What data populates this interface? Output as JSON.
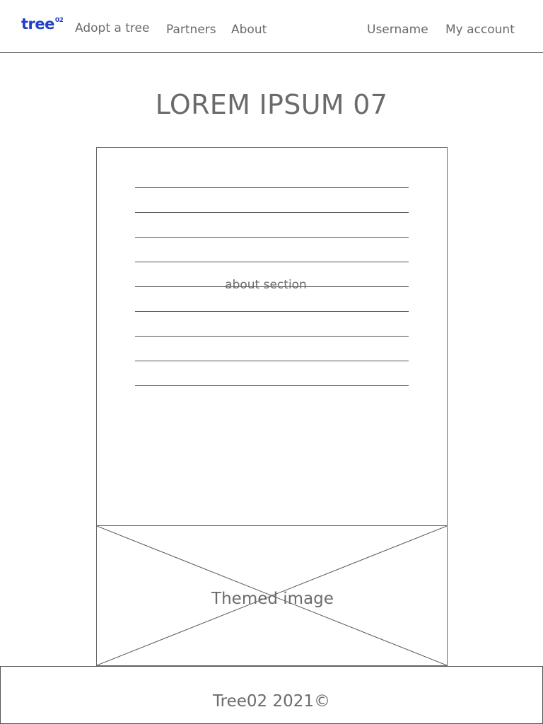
{
  "header": {
    "logo_text": "tree",
    "logo_superscript": "02",
    "nav": {
      "adopt": "Adopt a tree",
      "partners": "Partners",
      "about": "About"
    },
    "user": {
      "username": "Username",
      "account": "My account"
    }
  },
  "main": {
    "title": "LOREM IPSUM 07",
    "about_section_label": "about section",
    "image_label": "Themed image"
  },
  "footer": {
    "text": "Tree02 2021©"
  },
  "colors": {
    "brand": "#1f3fc4",
    "text": "#6b6b6b",
    "border": "#555555"
  }
}
